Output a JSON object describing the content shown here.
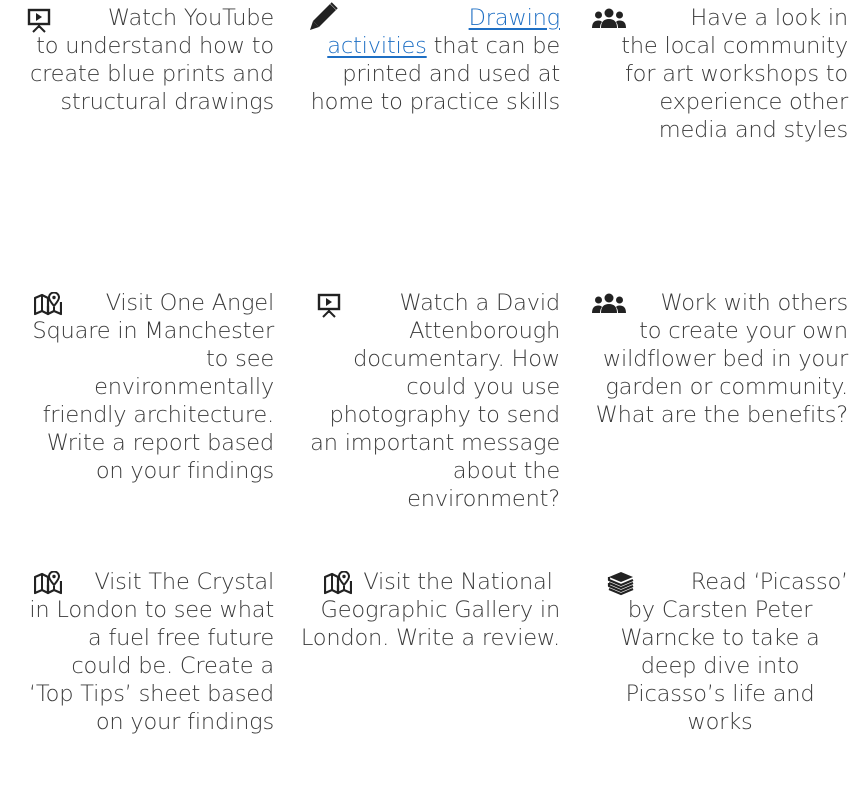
{
  "activities": {
    "watch_youtube": {
      "icon": "presentation-icon",
      "line1": "Watch YouTube",
      "rest": "to understand how to create blue prints and structural drawings"
    },
    "drawing_activities": {
      "icon": "pencil-icon",
      "link_text_1": "Drawing",
      "link_text_2": "activities",
      "rest": " that can be printed and used at home to practice skills",
      "link_color": "#1e6fc4"
    },
    "art_workshops": {
      "icon": "users-icon",
      "line1": "Have a look in",
      "rest": "the local community for art workshops to experience other media and styles"
    },
    "one_angel_square": {
      "icon": "map-pin-icon",
      "line1": "Visit One Angel",
      "rest": "Square in Manchester to see environmentally friendly architecture. Write a report based on your findings"
    },
    "attenborough": {
      "icon": "presentation-icon",
      "line1": "Watch a David",
      "rest": "Attenborough documentary. How could you use photography to send an important message about the environment?"
    },
    "wildflower_bed": {
      "icon": "users-icon",
      "line1": "Work with others",
      "rest": "to create your own wildflower bed in your garden or community. What are the benefits?"
    },
    "the_crystal": {
      "icon": "map-pin-icon",
      "line1": "Visit The Crystal",
      "rest": "in London to see what a fuel free future could be. Create a ‘Top Tips’ sheet based on your findings"
    },
    "national_geographic": {
      "icon": "map-pin-icon",
      "line1": "Visit the National",
      "rest": "Geographic Gallery in London. Write a review."
    },
    "picasso": {
      "icon": "books-icon",
      "line1": "Read ‘Picasso’",
      "rest": "by Carsten Peter Warncke to take a deep dive into Picasso’s life and works"
    }
  },
  "colors": {
    "text": "#3a3a3a",
    "icon": "#222222",
    "link": "#1e6fc4"
  }
}
